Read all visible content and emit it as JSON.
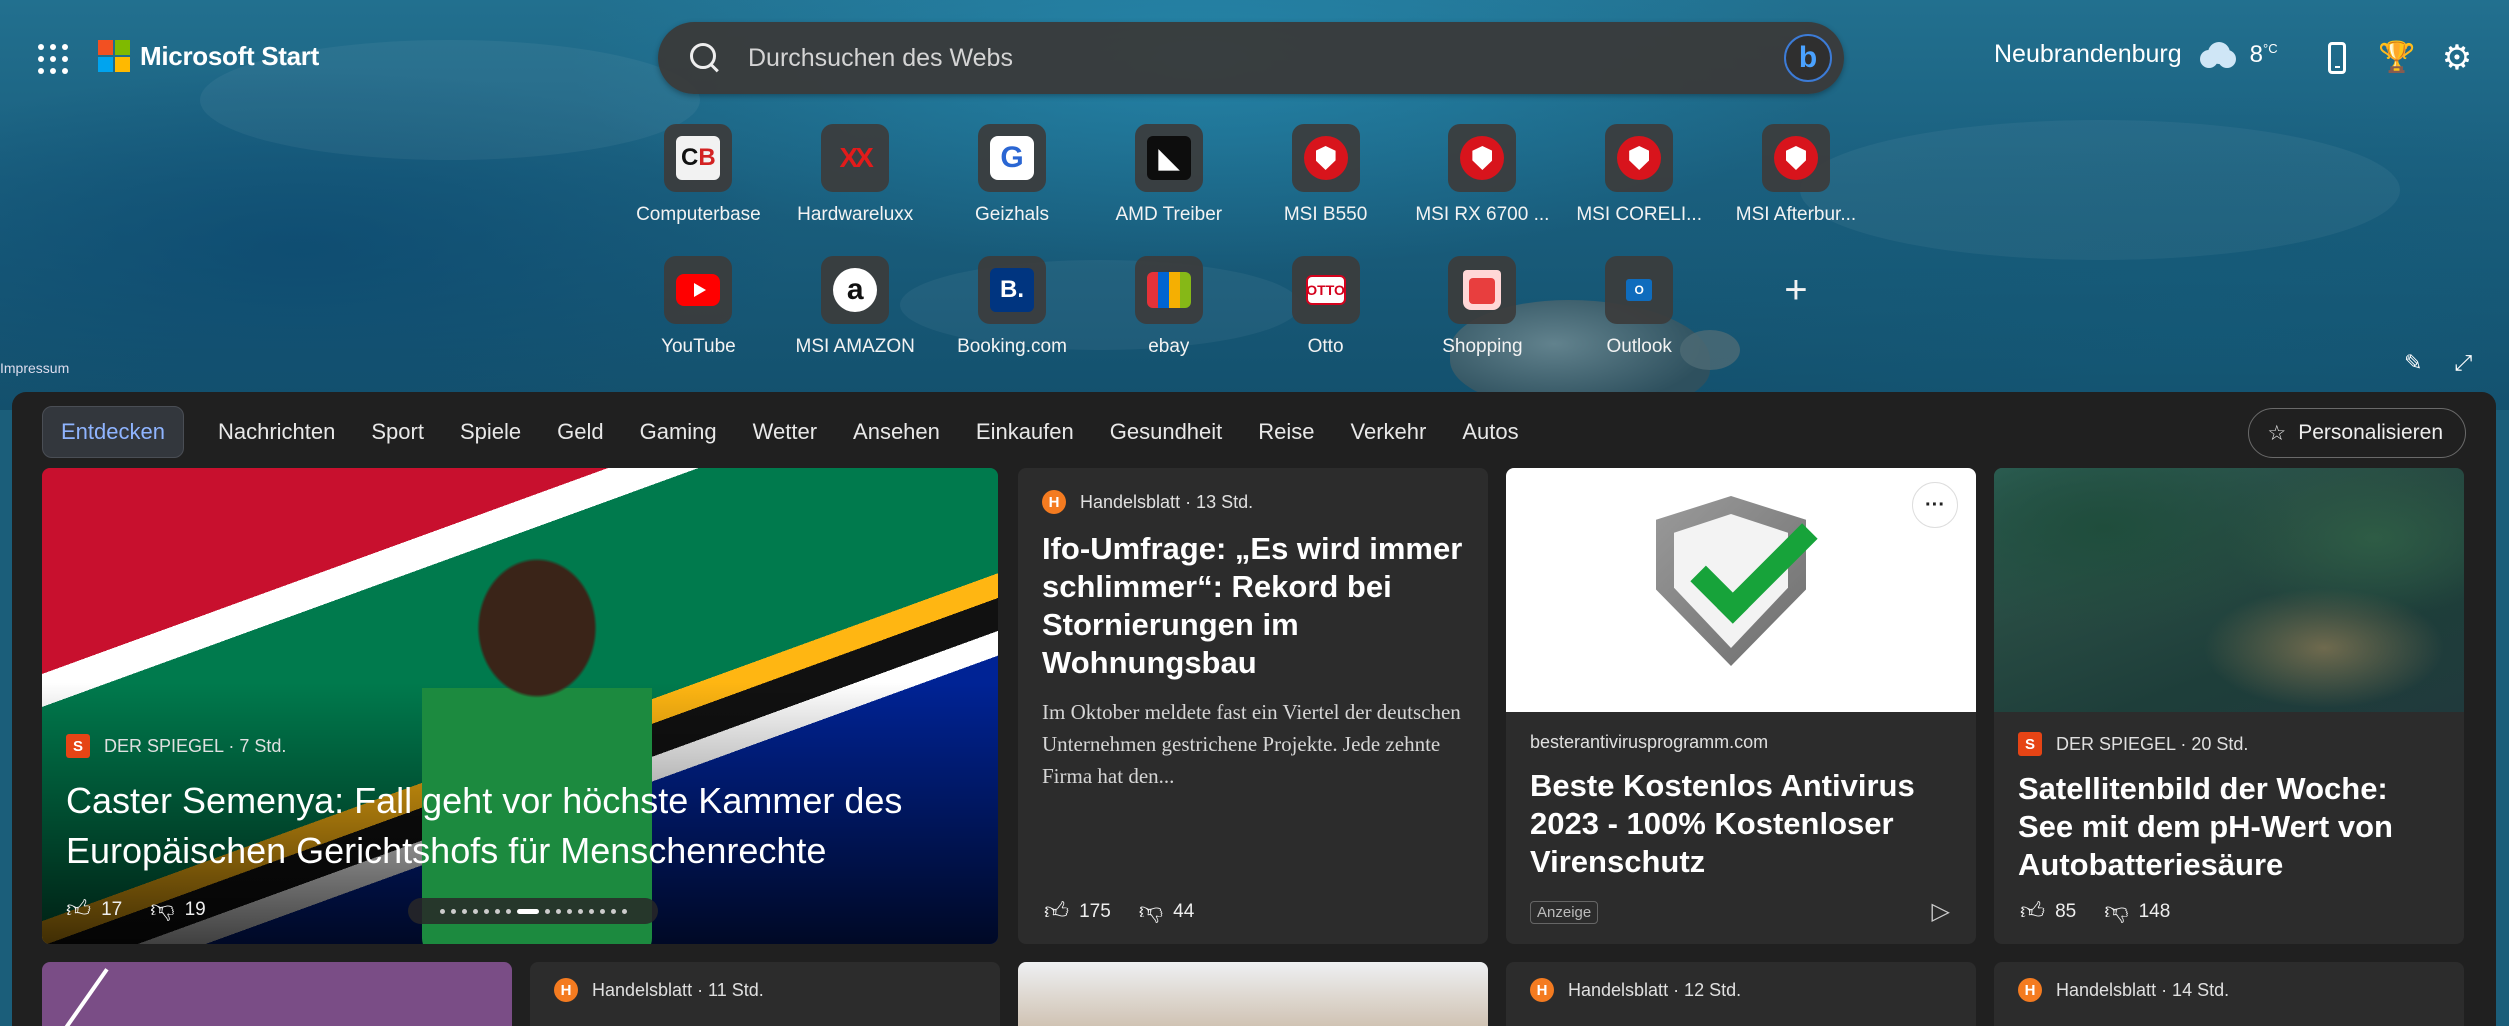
{
  "header": {
    "brand": "Microsoft Start",
    "search_placeholder": "Durchsuchen des Webs",
    "bing_label": "b",
    "weather_city": "Neubrandenburg",
    "weather_temp": "8",
    "weather_unit": "°C"
  },
  "quicklinks": [
    {
      "label": "Computerbase",
      "icon": "computerbase-icon"
    },
    {
      "label": "Hardwareluxx",
      "icon": "hardwareluxx-icon"
    },
    {
      "label": "Geizhals",
      "icon": "geizhals-icon"
    },
    {
      "label": "AMD Treiber",
      "icon": "amd-icon"
    },
    {
      "label": "MSI B550",
      "icon": "msi-icon"
    },
    {
      "label": "MSI RX 6700 ...",
      "icon": "msi-icon"
    },
    {
      "label": "MSI CORELI...",
      "icon": "msi-icon"
    },
    {
      "label": "MSI Afterbur...",
      "icon": "msi-icon"
    },
    {
      "label": "YouTube",
      "icon": "youtube-icon"
    },
    {
      "label": "MSI AMAZON",
      "icon": "amazon-icon"
    },
    {
      "label": "Booking.com",
      "icon": "booking-icon"
    },
    {
      "label": "ebay",
      "icon": "ebay-icon"
    },
    {
      "label": "Otto",
      "icon": "otto-icon"
    },
    {
      "label": "Shopping",
      "icon": "shopping-icon"
    },
    {
      "label": "Outlook",
      "icon": "outlook-icon"
    }
  ],
  "impressum": "Impressum",
  "nav": {
    "items": [
      "Entdecken",
      "Nachrichten",
      "Sport",
      "Spiele",
      "Geld",
      "Gaming",
      "Wetter",
      "Ansehen",
      "Einkaufen",
      "Gesundheit",
      "Reise",
      "Verkehr",
      "Autos"
    ],
    "personalize": "Personalisieren"
  },
  "cards": {
    "hero": {
      "source": "DER SPIEGEL · 7 Std.",
      "title": "Caster Semenya: Fall geht vor höchste Kammer des Europäischen Gerichtshofs für Menschenrechte",
      "likes": "17",
      "dislikes": "19"
    },
    "c2": {
      "source": "Handelsblatt · 13 Std.",
      "title": "Ifo-Umfrage: „Es wird immer schlimmer“: Rekord bei Stornierungen im Wohnungsbau",
      "body": "Im Oktober meldete fast ein Viertel der deutschen Unternehmen gestrichene Projekte. Jede zehnte Firma hat den...",
      "likes": "175",
      "dislikes": "44"
    },
    "c3": {
      "source": "besterantivirusprogramm.com",
      "title": "Beste Kostenlos Antivirus 2023 - 100% Kostenloser Virenschutz",
      "ad": "Anzeige"
    },
    "c4": {
      "source": "DER SPIEGEL · 20 Std.",
      "title": "Satellitenbild der Woche: See mit dem pH-Wert von Autobatteriesäure",
      "likes": "85",
      "dislikes": "148"
    },
    "row2": {
      "b_source": "Handelsblatt · 11 Std.",
      "d_source": "Handelsblatt · 12 Std.",
      "e_source": "Handelsblatt · 14 Std."
    }
  }
}
